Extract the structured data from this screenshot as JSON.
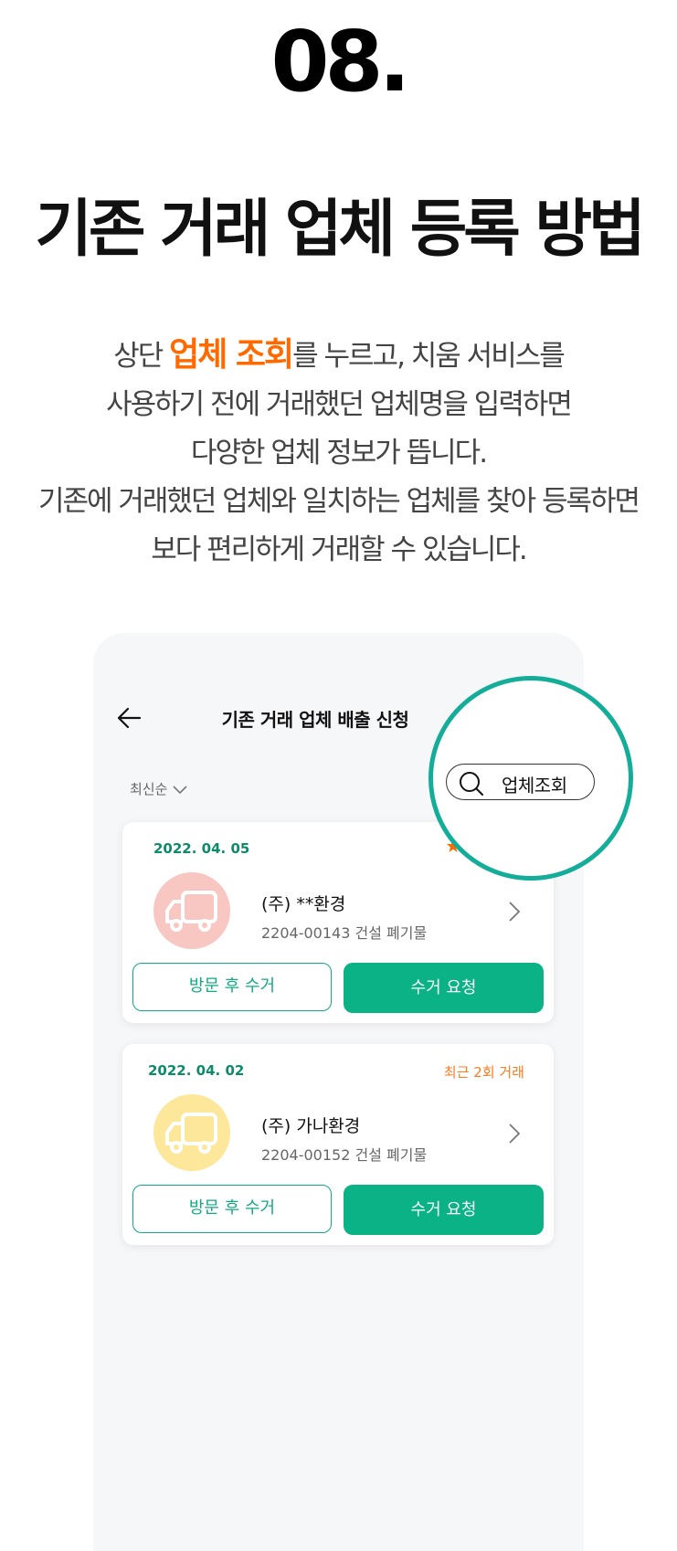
{
  "step_number": "08.",
  "heading": "기존 거래 업체 등록 방법",
  "description": {
    "line1_before": "상단 ",
    "line1_highlight": "업체 조회",
    "line1_after": "를 누르고, 치움 서비스를",
    "line2": "사용하기 전에 거래했던 업체명을 입력하면",
    "line3": "다양한 업체 정보가 뜹니다.",
    "line4": "기존에 거래했던 업체와 일치하는 업체를 찾아 등록하면",
    "line5": "보다 편리하게 거래할 수 있습니다."
  },
  "app": {
    "title": "기존 거래 업체 배출 신청",
    "back_icon": "arrow-left-icon",
    "sort_label": "최신순",
    "search_label": "업체조회",
    "cards": [
      {
        "date": "2022. 04. 05",
        "recent": "",
        "name": "(주) **환경",
        "sub": "2204-00143 건설 폐기물",
        "avatar_color": "#f9c7c2",
        "btn_visit": "방문 후 수거",
        "btn_request": "수거 요청"
      },
      {
        "date": "2022. 04. 02",
        "recent": "최근 2회 거래",
        "name": "(주) 가나환경",
        "sub": "2204-00152 건설 폐기물",
        "avatar_color": "#fde79a",
        "btn_visit": "방문 후 수거",
        "btn_request": "수거 요청"
      }
    ]
  },
  "colors": {
    "accent_orange": "#ff6a00",
    "primary_green": "#0ab286",
    "magnifier_teal": "#14ad99"
  }
}
